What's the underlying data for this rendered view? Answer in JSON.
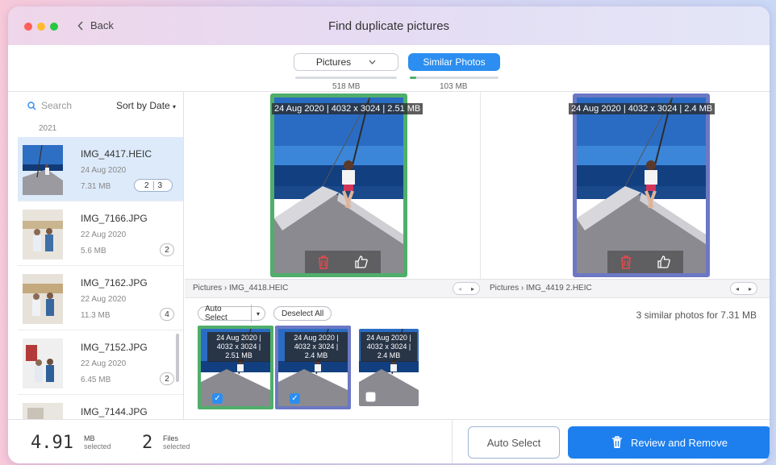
{
  "window": {
    "back_label": "Back",
    "title": "Find duplicate pictures"
  },
  "segments": {
    "pictures_label": "Pictures",
    "pictures_size": "518 MB",
    "similar_label": "Similar Photos",
    "similar_size": "103 MB"
  },
  "sidebar": {
    "search_placeholder": "Search",
    "sort_label": "Sort by Date",
    "year": "2021",
    "items": [
      {
        "name": "IMG_4417.HEIC",
        "date": "24 Aug 2020",
        "size": "7.31 MB",
        "badge_a": "2",
        "badge_b": "3",
        "selected": true
      },
      {
        "name": "IMG_7166.JPG",
        "date": "22 Aug 2020",
        "size": "5.6 MB",
        "badge": "2"
      },
      {
        "name": "IMG_7162.JPG",
        "date": "22 Aug 2020",
        "size": "11.3 MB",
        "badge": "4"
      },
      {
        "name": "IMG_7152.JPG",
        "date": "22 Aug 2020",
        "size": "6.45 MB",
        "badge": "2"
      },
      {
        "name": "IMG_7144.JPG"
      }
    ]
  },
  "preview": {
    "left_caption": "24 Aug 2020 | 4032 x 3024 | 2.51 MB",
    "right_caption": "24 Aug 2020 | 4032 x 3024 | 2.4 MB",
    "left_path": "Pictures › IMG_4418.HEIC",
    "right_path": "Pictures › IMG_4419 2.HEIC",
    "left_border": "#4fae6b",
    "right_border": "#6c78c4"
  },
  "controls": {
    "auto_select_label": "Auto Select",
    "deselect_all_label": "Deselect All",
    "similar_note": "3 similar photos for 7.31 MB"
  },
  "tiles": [
    {
      "line1": "24 Aug 2020 |",
      "line2": "4032 x 3024 |",
      "line3": "2.51 MB",
      "checked": true,
      "border": "#4fae6b"
    },
    {
      "line1": "24 Aug 2020 |",
      "line2": "4032 x 3024 |",
      "line3": "2.4 MB",
      "checked": true,
      "border": "#6c78c4"
    },
    {
      "line1": "24 Aug 2020 |",
      "line2": "4032 x 3024 |",
      "line3": "2.4 MB",
      "checked": false,
      "border": "none"
    }
  ],
  "footer": {
    "selected_size": "4.91",
    "size_unit": "MB",
    "size_sub": "selected",
    "files_count": "2",
    "files_unit": "Files",
    "files_sub": "selected",
    "auto_select_button": "Auto Select",
    "review_button": "Review and Remove"
  },
  "colors": {
    "accent": "#1d7fee",
    "traffic_close": "#ff5f57",
    "traffic_min": "#febc2e",
    "traffic_max": "#28c840"
  },
  "icons": [
    "chevron-left-icon",
    "search-icon",
    "chevron-down-icon",
    "trash-icon",
    "thumbs-up-icon",
    "checkmark-icon"
  ]
}
